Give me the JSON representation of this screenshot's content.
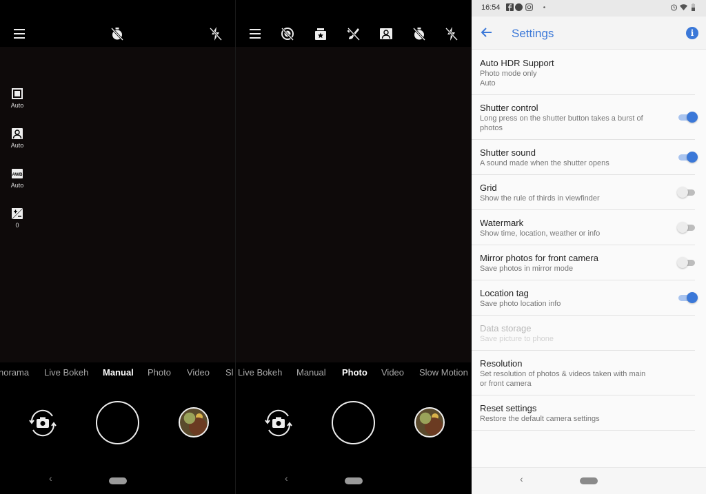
{
  "left_camera": {
    "top_icons": [
      "menu-icon",
      "timer-off-icon",
      "flash-off-icon"
    ],
    "side_controls": [
      {
        "icon": "exposure-metering-icon",
        "label": "Auto"
      },
      {
        "icon": "portrait-icon",
        "label": "Auto"
      },
      {
        "icon": "awb-icon",
        "label": "Auto"
      },
      {
        "icon": "exposure-compensation-icon",
        "label": "0"
      }
    ],
    "modes": [
      "norama",
      "Live Bokeh",
      "Manual",
      "Photo",
      "Video",
      "Sl"
    ],
    "active_mode": "Manual"
  },
  "middle_camera": {
    "top_icons": [
      "menu-icon",
      "hdr-off-icon",
      "bothie-icon",
      "beauty-off-icon",
      "portrait-frame-icon",
      "timer-off-icon",
      "flash-off-icon"
    ],
    "modes": [
      "Live Bokeh",
      "Manual",
      "Photo",
      "Video",
      "Slow Motion"
    ],
    "active_mode": "Photo"
  },
  "navigation": {
    "back_glyph": "‹"
  },
  "settings": {
    "status_bar": {
      "time": "16:54",
      "notifications": [
        "facebook-icon",
        "messenger-icon",
        "instagram-icon",
        "dot-icon"
      ],
      "status_icons": [
        "alarm-icon",
        "wifi-icon",
        "battery-icon"
      ]
    },
    "title": "Settings",
    "info_glyph": "i",
    "accent_color": "#3b78d8",
    "items": [
      {
        "title": "Auto HDR Support",
        "subtitle": "Photo mode only",
        "value": "Auto",
        "toggle": null,
        "disabled": false
      },
      {
        "title": "Shutter control",
        "subtitle": "Long press on the shutter button takes a burst of photos",
        "toggle": true,
        "disabled": false
      },
      {
        "title": "Shutter sound",
        "subtitle": "A sound made when the shutter opens",
        "toggle": true,
        "disabled": false
      },
      {
        "title": "Grid",
        "subtitle": "Show the rule of thirds in viewfinder",
        "toggle": false,
        "disabled": false
      },
      {
        "title": "Watermark",
        "subtitle": "Show time, location, weather or info",
        "toggle": false,
        "disabled": false
      },
      {
        "title": "Mirror photos for front camera",
        "subtitle": "Save photos in mirror mode",
        "toggle": false,
        "disabled": false
      },
      {
        "title": "Location tag",
        "subtitle": "Save photo location info",
        "toggle": true,
        "disabled": false
      },
      {
        "title": "Data storage",
        "subtitle": "Save picture to phone",
        "toggle": null,
        "disabled": true
      },
      {
        "title": "Resolution",
        "subtitle": "Set resolution of photos & videos taken with main or front camera",
        "toggle": null,
        "disabled": false
      },
      {
        "title": "Reset settings",
        "subtitle": "Restore the default camera settings",
        "toggle": null,
        "disabled": false
      }
    ]
  }
}
